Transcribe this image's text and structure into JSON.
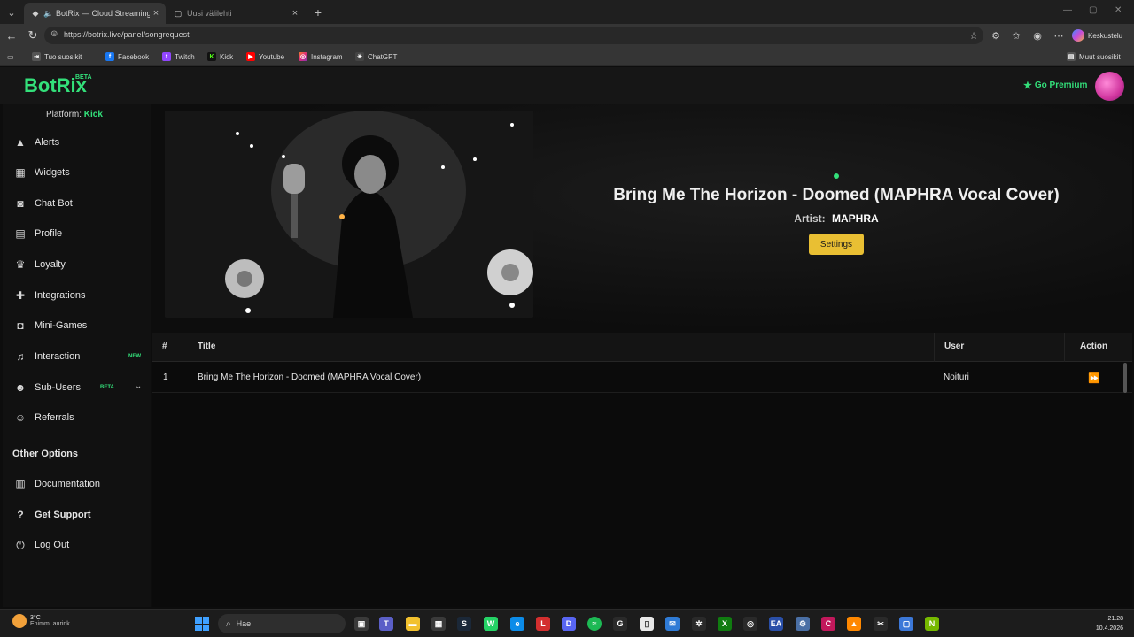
{
  "browser": {
    "tabs": [
      {
        "title": "BotRix — Cloud Streaming Bo",
        "active": true
      },
      {
        "title": "Uusi välilehti",
        "active": false
      }
    ],
    "url": "https://botrix.live/panel/songrequest",
    "copilot_label": "Keskustelu",
    "bookmarks": [
      "Tuo suosikit",
      "Facebook",
      "Twitch",
      "Kick",
      "Youtube",
      "Instagram",
      "ChatGPT"
    ],
    "other_bookmarks": "Muut suosikit"
  },
  "header": {
    "logo": "BotRix",
    "logo_badge": "BETA",
    "premium_label": "Go Premium"
  },
  "sidebar": {
    "platform_label": "Platform:",
    "platform_value": "Kick",
    "items": [
      {
        "label": "Alerts",
        "icon": "warning-icon"
      },
      {
        "label": "Widgets",
        "icon": "grid-icon"
      },
      {
        "label": "Chat Bot",
        "icon": "robot-icon"
      },
      {
        "label": "Profile",
        "icon": "id-card-icon"
      },
      {
        "label": "Loyalty",
        "icon": "trophy-icon"
      },
      {
        "label": "Integrations",
        "icon": "puzzle-icon"
      },
      {
        "label": "Mini-Games",
        "icon": "gamepad-icon"
      },
      {
        "label": "Interaction",
        "icon": "music-icon",
        "badge": "NEW"
      },
      {
        "label": "Sub-Users",
        "icon": "users-icon",
        "badge": "BETA"
      },
      {
        "label": "Referrals",
        "icon": "user-group-icon"
      }
    ],
    "other_options_title": "Other Options",
    "other_items": [
      {
        "label": "Documentation",
        "icon": "book-icon"
      },
      {
        "label": "Get Support",
        "icon": "question-icon"
      },
      {
        "label": "Log Out",
        "icon": "power-icon"
      }
    ]
  },
  "now_playing": {
    "title": "Bring Me The Horizon - Doomed (MAPHRA Vocal Cover)",
    "artist_label": "Artist:",
    "artist": "MAPHRA",
    "settings_label": "Settings"
  },
  "queue": {
    "columns": [
      "#",
      "Title",
      "User",
      "Action"
    ],
    "rows": [
      {
        "index": "1",
        "title": "Bring Me The Horizon - Doomed (MAPHRA Vocal Cover)",
        "user": "Noituri"
      }
    ]
  },
  "taskbar": {
    "weather_temp": "3°C",
    "weather_desc": "Enimm. aurink.",
    "search_placeholder": "Hae",
    "time": "21.28",
    "date": "10.4.2026"
  },
  "colors": {
    "accent": "#33e07a",
    "settings_button": "#e9bf33",
    "background": "#0d0d0d"
  }
}
